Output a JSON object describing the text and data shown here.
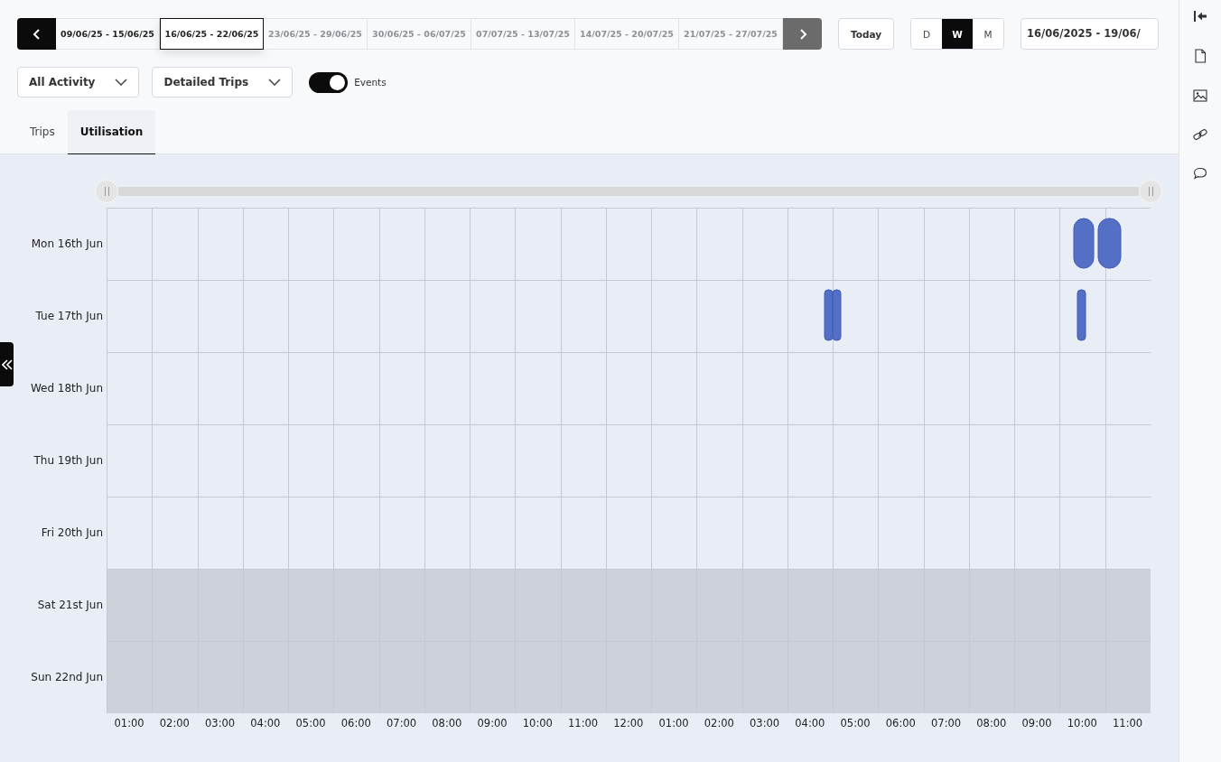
{
  "week_nav": {
    "weeks": [
      {
        "label": "09/06/25 - 15/06/25",
        "selected": false,
        "disabled": false
      },
      {
        "label": "16/06/25 - 22/06/25",
        "selected": true,
        "disabled": false
      },
      {
        "label": "23/06/25 - 29/06/25",
        "selected": false,
        "disabled": true
      },
      {
        "label": "30/06/25 - 06/07/25",
        "selected": false,
        "disabled": true
      },
      {
        "label": "07/07/25 - 13/07/25",
        "selected": false,
        "disabled": true
      },
      {
        "label": "14/07/25 - 20/07/25",
        "selected": false,
        "disabled": true
      },
      {
        "label": "21/07/25 - 27/07/25",
        "selected": false,
        "disabled": true
      }
    ]
  },
  "today_button": "Today",
  "view_modes": [
    {
      "label": "D",
      "selected": false
    },
    {
      "label": "W",
      "selected": true
    },
    {
      "label": "M",
      "selected": false
    }
  ],
  "date_range": {
    "value": "16/06/2025 - 19/06/"
  },
  "zoom_slider": {
    "level": 1
  },
  "filters": [
    {
      "label": "All Activity"
    },
    {
      "label": "Detailed Trips"
    }
  ],
  "events_toggle": {
    "label": "Events",
    "on": true
  },
  "tabs": [
    {
      "label": "Trips",
      "selected": false
    },
    {
      "label": "Utilisation",
      "selected": true
    }
  ],
  "utilisation": {
    "days": [
      {
        "label": "Mon 16th Jun",
        "weekend": false
      },
      {
        "label": "Tue 17th Jun",
        "weekend": false
      },
      {
        "label": "Wed 18th Jun",
        "weekend": false
      },
      {
        "label": "Thu 19th Jun",
        "weekend": false
      },
      {
        "label": "Fri 20th Jun",
        "weekend": false
      },
      {
        "label": "Sat 21st Jun",
        "weekend": true
      },
      {
        "label": "Sun 22nd Jun",
        "weekend": true
      }
    ],
    "hours": [
      "01:00",
      "02:00",
      "03:00",
      "04:00",
      "05:00",
      "06:00",
      "07:00",
      "08:00",
      "09:00",
      "10:00",
      "11:00",
      "12:00",
      "01:00",
      "02:00",
      "03:00",
      "04:00",
      "05:00",
      "06:00",
      "07:00",
      "08:00",
      "09:00",
      "10:00",
      "11:00"
    ]
  }
}
